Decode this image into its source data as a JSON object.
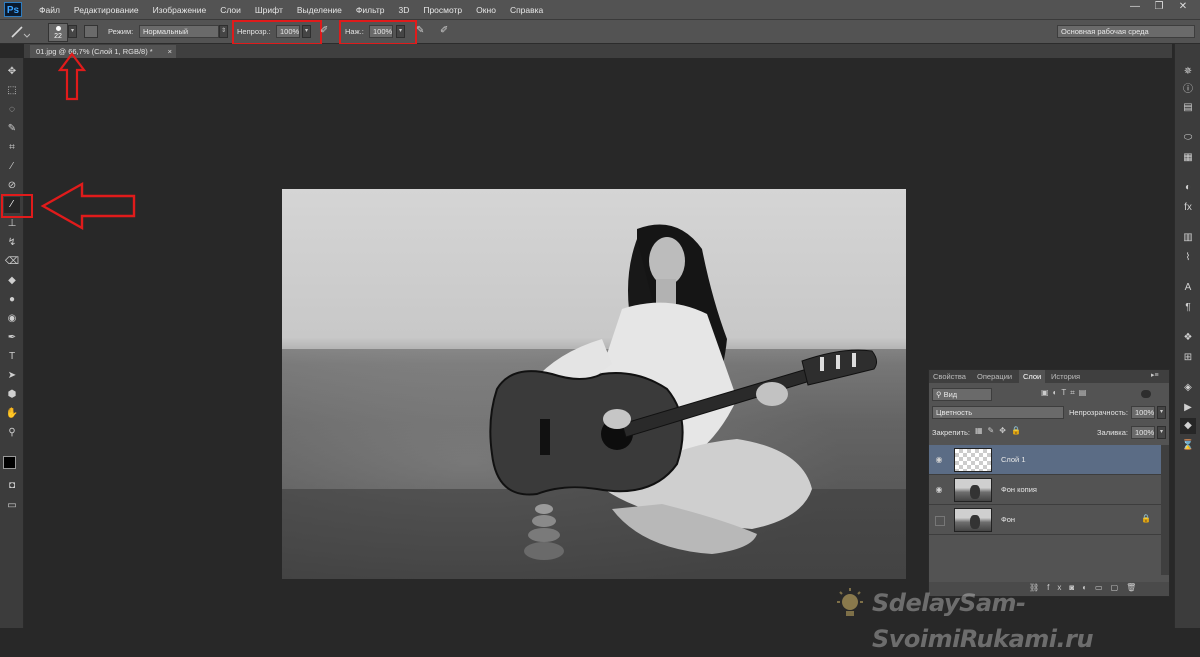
{
  "app": {
    "logo": "Ps"
  },
  "menu": [
    "Файл",
    "Редактирование",
    "Изображение",
    "Слои",
    "Шрифт",
    "Выделение",
    "Фильтр",
    "3D",
    "Просмотр",
    "Окно",
    "Справка"
  ],
  "window_controls": {
    "minimize": "—",
    "restore": "❐",
    "close": "✕"
  },
  "options": {
    "brush_size": "22",
    "mode_label": "Режим:",
    "mode_value": "Нормальный",
    "opacity_label": "Непрозр.:",
    "opacity_value": "100%",
    "pressure_label": "Наж.:",
    "pressure_value": "100%",
    "workspace": "Основная рабочая среда"
  },
  "document_tab": {
    "title": "01.jpg @ 66,7% (Слой 1, RGB/8) *",
    "close": "×"
  },
  "layers_panel": {
    "tabs": [
      "Свойства",
      "Операции",
      "Слои",
      "История"
    ],
    "active_tab": "Слои",
    "filter_label": "Вид",
    "blend_mode": "Цветность",
    "opacity_label": "Непрозрачность:",
    "opacity_value": "100%",
    "lock_label": "Закрепить:",
    "fill_label": "Заливка:",
    "fill_value": "100%",
    "layers": [
      {
        "name": "Слой 1",
        "selected": true,
        "visible": true,
        "locked": false
      },
      {
        "name": "Фон копия",
        "selected": false,
        "visible": true,
        "locked": false
      },
      {
        "name": "Фон",
        "selected": false,
        "visible": false,
        "locked": true
      }
    ]
  },
  "watermark": {
    "text": "SdelaySam-SvoimiRukami.ru"
  },
  "colors": {
    "highlight": "#e01b1b",
    "panel": "#535353",
    "workspace": "#282828",
    "selected_layer": "#5b6c85"
  }
}
